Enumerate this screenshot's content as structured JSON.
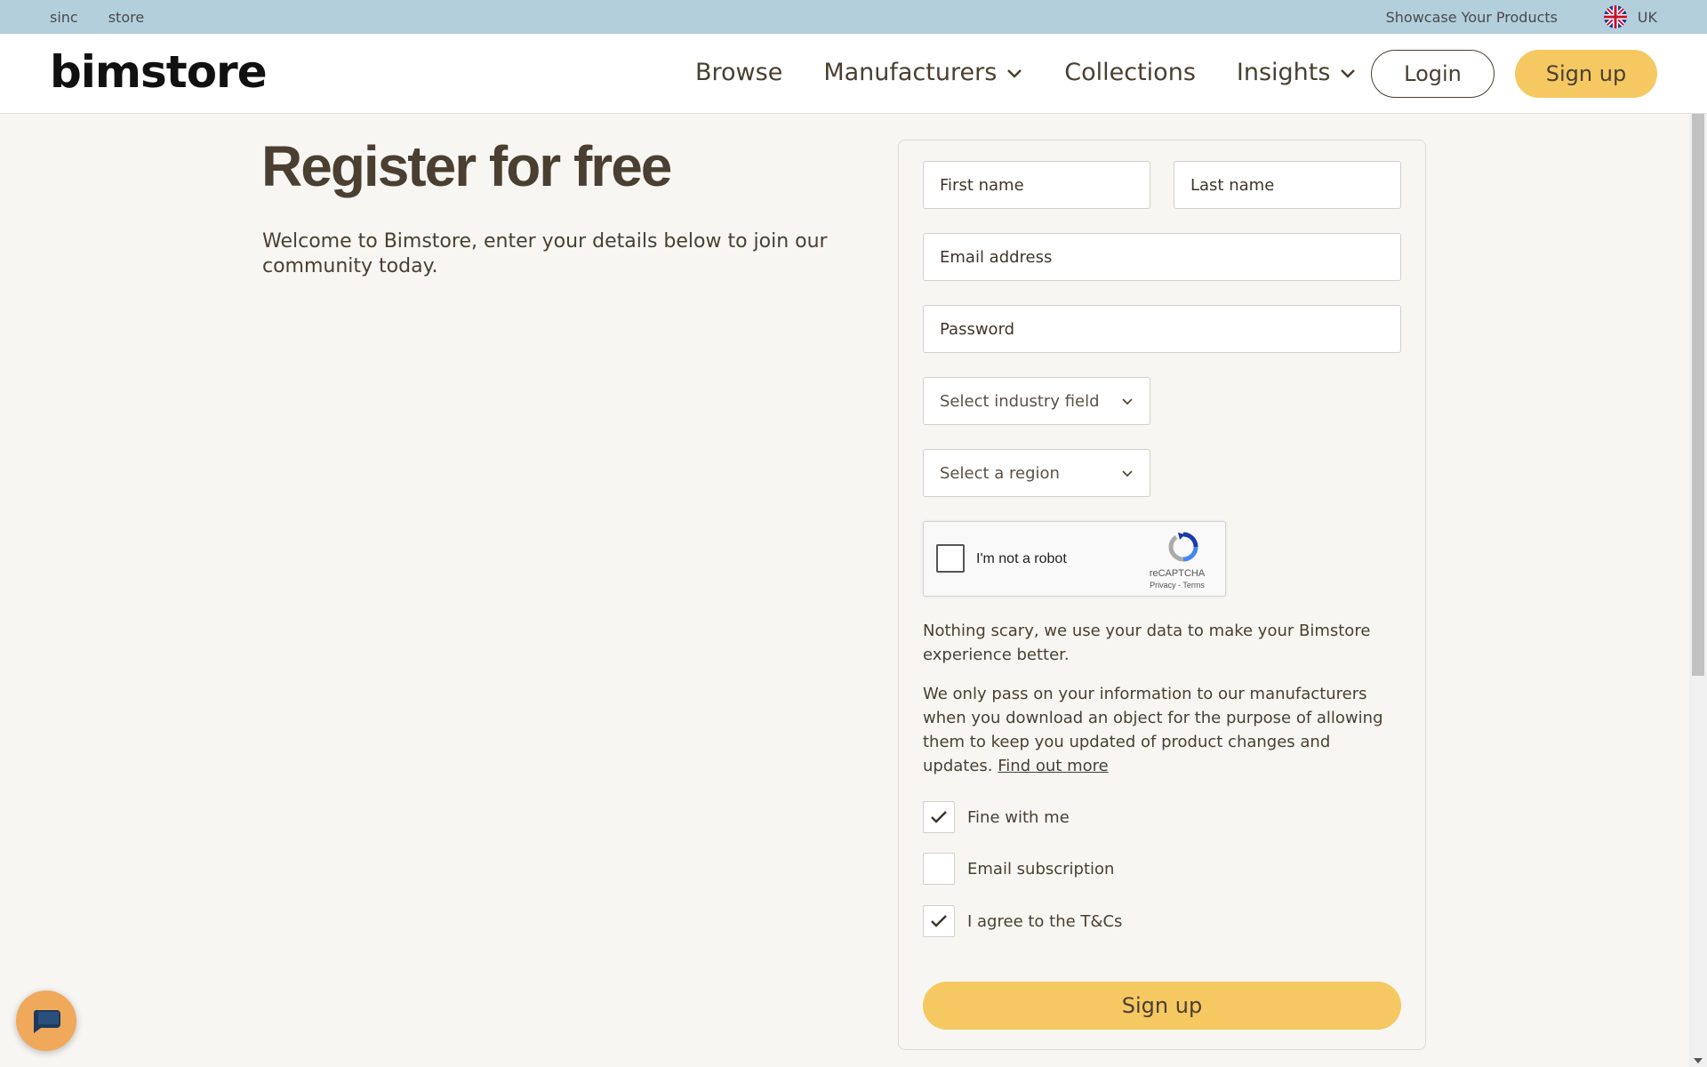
{
  "utility_bar": {
    "links": [
      "sinc",
      "store"
    ],
    "showcase": "Showcase Your Products",
    "region": "UK"
  },
  "header": {
    "logo": "bimstore",
    "nav": {
      "browse": "Browse",
      "manufacturers": "Manufacturers",
      "collections": "Collections",
      "insights": "Insights"
    },
    "login": "Login",
    "signup": "Sign up"
  },
  "intro": {
    "title": "Register for free",
    "text": "Welcome to Bimstore, enter your details below to join our community today."
  },
  "form": {
    "first_name": "First name",
    "last_name": "Last name",
    "email": "Email address",
    "password": "Password",
    "industry": "Select industry field",
    "region": "Select a region",
    "captcha": {
      "label": "I'm not a robot",
      "brand": "reCAPTCHA",
      "links": "Privacy - Terms"
    },
    "note1": "Nothing scary, we use your data to make your Bimstore experience better.",
    "note2": "We only pass on your information to our manufacturers when you download an object for the purpose of allowing them to keep you updated of product changes and updates.",
    "find_out_more": "Find out more",
    "checks": {
      "fine": {
        "label": "Fine with me",
        "checked": true
      },
      "email_sub": {
        "label": "Email subscription",
        "checked": false
      },
      "tcs": {
        "label": "I agree to the T&Cs",
        "checked": true
      }
    },
    "submit": "Sign up"
  },
  "colors": {
    "accent": "#f5c862",
    "utility_bar": "#b3cfdc",
    "text": "#4a3f30",
    "chat": "#f0a95b"
  }
}
